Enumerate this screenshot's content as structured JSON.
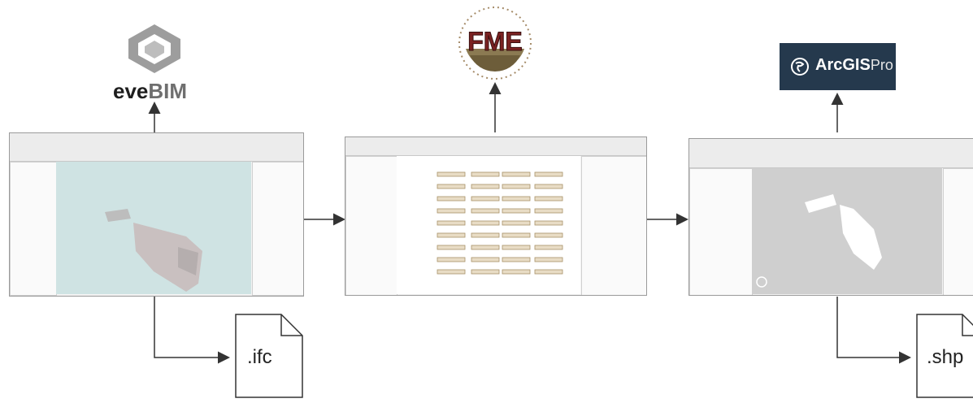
{
  "logos": {
    "evebim": {
      "prefix": "eve",
      "suffix": "BIM"
    },
    "fme": {
      "text": "FME"
    },
    "arcgis": {
      "main": "ArcGIS",
      "sub": "Pro",
      "bg": "#25394d"
    }
  },
  "files": {
    "ifc": ".ifc",
    "shp": ".shp"
  },
  "colors": {
    "arrow": "#333333",
    "evebim_viewport": "#cfe3e3",
    "arcgis_viewport": "#cfcfcf",
    "fme_canvas": "#ffffff"
  }
}
